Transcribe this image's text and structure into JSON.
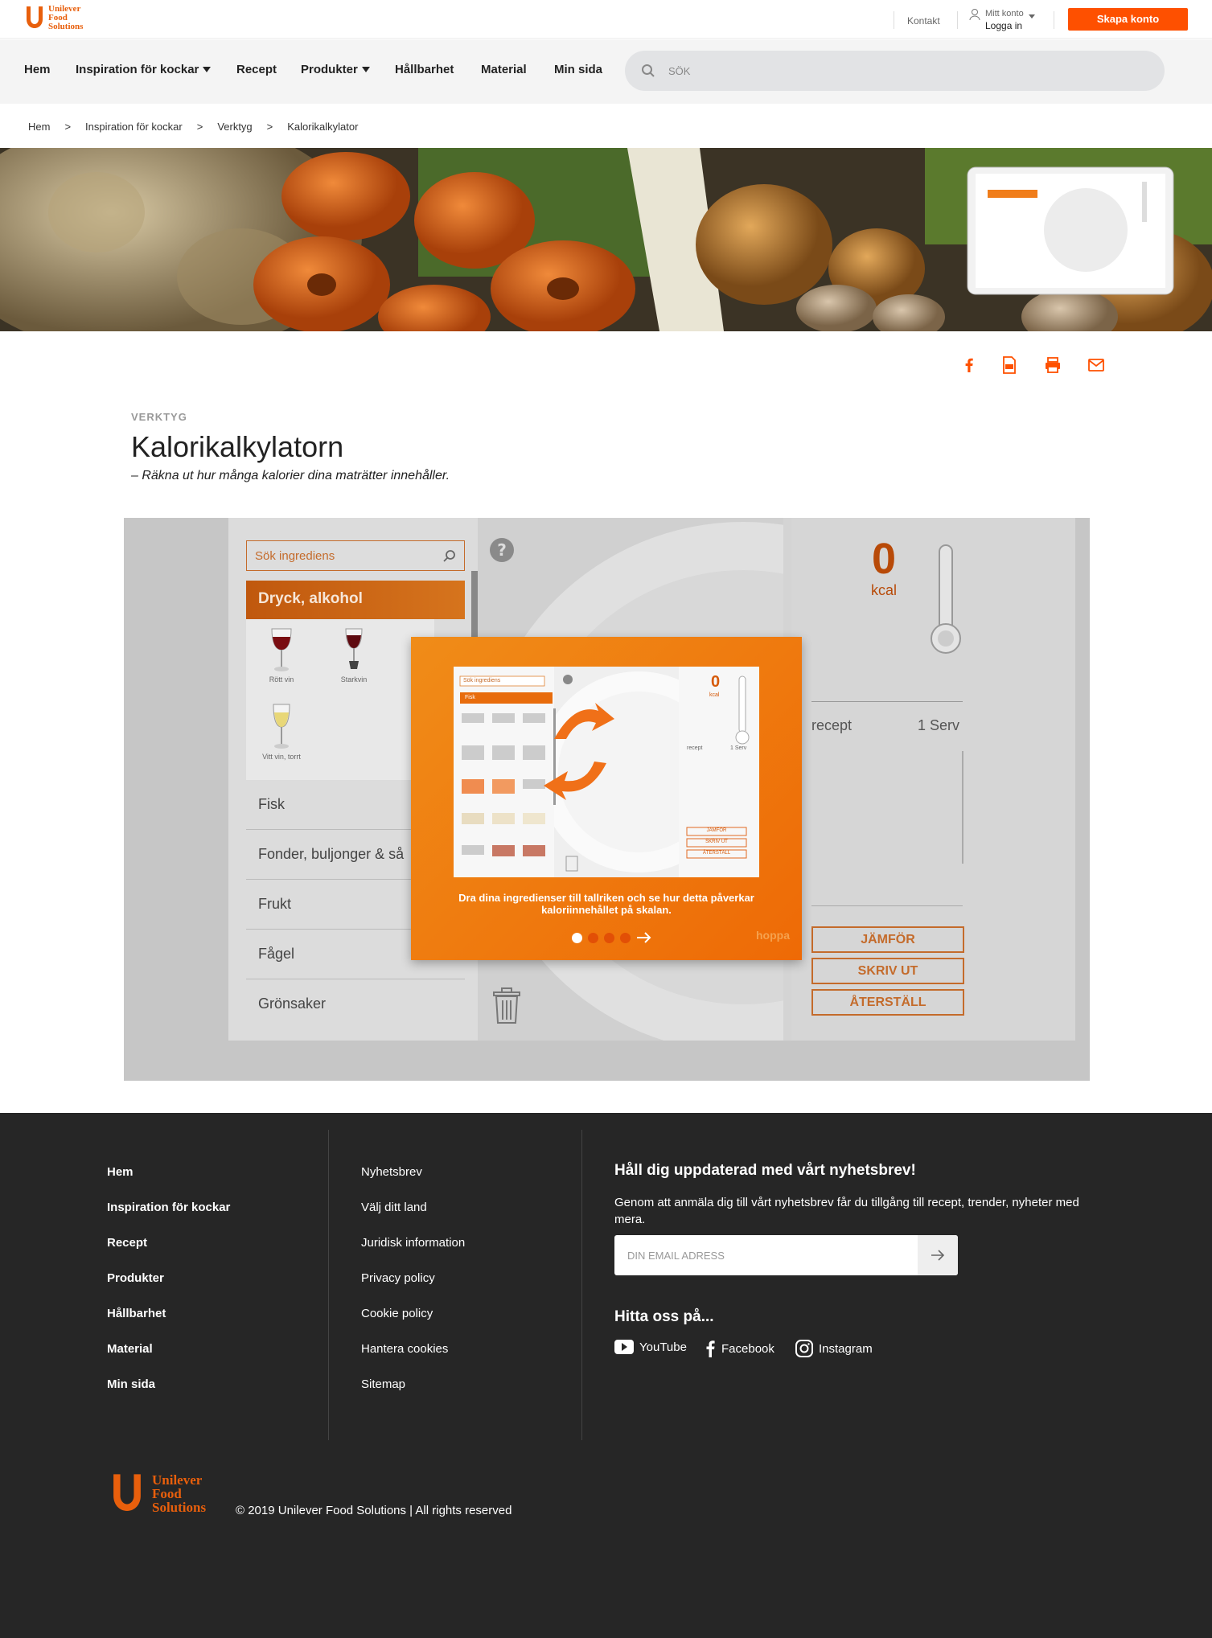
{
  "header": {
    "logo_lines": [
      "Unilever",
      "Food",
      "Solutions"
    ],
    "kontakt": "Kontakt",
    "mitt_konto": "Mitt konto",
    "logga_in": "Logga in",
    "skapa_konto": "Skapa konto"
  },
  "nav": {
    "items": [
      "Hem",
      "Inspiration för kockar",
      "Recept",
      "Produkter",
      "Hållbarhet",
      "Material",
      "Min sida"
    ],
    "search_placeholder": "SÖK"
  },
  "breadcrumb": [
    "Hem",
    ">",
    "Inspiration för kockar",
    ">",
    "Verktyg",
    ">",
    "Kalorikalkylator"
  ],
  "page": {
    "kicker": "VERKTYG",
    "title": "Kalorikalkylatorn",
    "subtitle": "– Räkna ut hur många kalorier dina maträtter innehåller."
  },
  "tool": {
    "search_placeholder": "Sök ingrediens",
    "active_category": "Dryck, alkohol",
    "drinks": [
      "Rött vin",
      "Starkvin",
      "Vitt vin, torrt"
    ],
    "categories": [
      "Fisk",
      "Fonder, buljonger & så",
      "Frukt",
      "Fågel",
      "Grönsaker"
    ],
    "kcal_value": "0",
    "kcal_label": "kcal",
    "recept_label": "recept",
    "serv_label": "1 Serv",
    "buttons": [
      "JÄMFÖR",
      "SKRIV UT",
      "ÅTERSTÄLL"
    ]
  },
  "modal": {
    "text": "Dra dina ingredienser till tallriken och se hur detta påverkar kaloriinnehållet på skalan.",
    "skip": "hoppa",
    "mini": {
      "search": "Sök ingrediens",
      "category": "Fisk",
      "kcal": "0",
      "kcal_label": "kcal",
      "recept": "recept",
      "serv": "1 Serv",
      "buttons": [
        "JÄMFÖR",
        "SKRIV UT",
        "ÅTERSTÄLL"
      ]
    }
  },
  "footer": {
    "col1": [
      "Hem",
      "Inspiration för kockar",
      "Recept",
      "Produkter",
      "Hållbarhet",
      "Material",
      "Min sida"
    ],
    "col2": [
      "Nyhetsbrev",
      "Välj ditt land",
      "Juridisk information",
      "Privacy policy",
      "Cookie policy",
      "Hantera cookies",
      "Sitemap"
    ],
    "newsletter_heading": "Håll dig uppdaterad med vårt nyhetsbrev!",
    "newsletter_text": "Genom att anmäla dig till vårt nyhetsbrev får du tillgång till recept, trender, nyheter med mera.",
    "email_placeholder": "DIN EMAIL ADRESS",
    "find_us": "Hitta oss på...",
    "social": [
      "YouTube",
      "Facebook",
      "Instagram"
    ],
    "copyright": "© 2019 Unilever Food Solutions | All rights reserved"
  },
  "colors": {
    "accent": "#fe5000",
    "footer_bg": "#262626",
    "nav_bg": "#f4f4f4"
  }
}
